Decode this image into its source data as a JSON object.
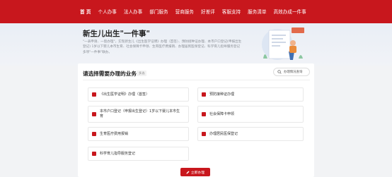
{
  "nav": {
    "items": [
      "首 页",
      "个人办事",
      "法人办事",
      "部门服务",
      "营商服务",
      "好差评",
      "客服支持",
      "服务清单",
      "高效办成一件事"
    ]
  },
  "hero": {
    "title": "新生儿出生\"一件事\"",
    "description": "\"一表申请、一窗办理\"，实现新生儿《出生医学证明》办理（首签）、预防接种证办理、本市户口登记(申报出生登记) 1岁以下婴儿本市生育、社会保障卡申领、生育医疗费报销、办理居民医保登记、科学育儿指导服务登记多项\"一件事\"联办。"
  },
  "section": {
    "title": "请选择需要办理的业务",
    "tag": "多选",
    "search_label": "办理情况查询"
  },
  "services": [
    "《出生医学证明》办理（首签）",
    "预防接种证办理",
    "本市户口登记（申报出生登记）1岁以下婴儿本市生育",
    "社会保障卡申领",
    "生育医疗费用报销",
    "办理居民医保登记",
    "科学育儿指导服务登记"
  ],
  "submit_label": "立即办理",
  "colors": {
    "primary": "#c8171d",
    "page_bg": "#f2f3f5"
  },
  "icons": {
    "search": "search-icon",
    "submit": "pen-icon",
    "service": "document-icon"
  }
}
